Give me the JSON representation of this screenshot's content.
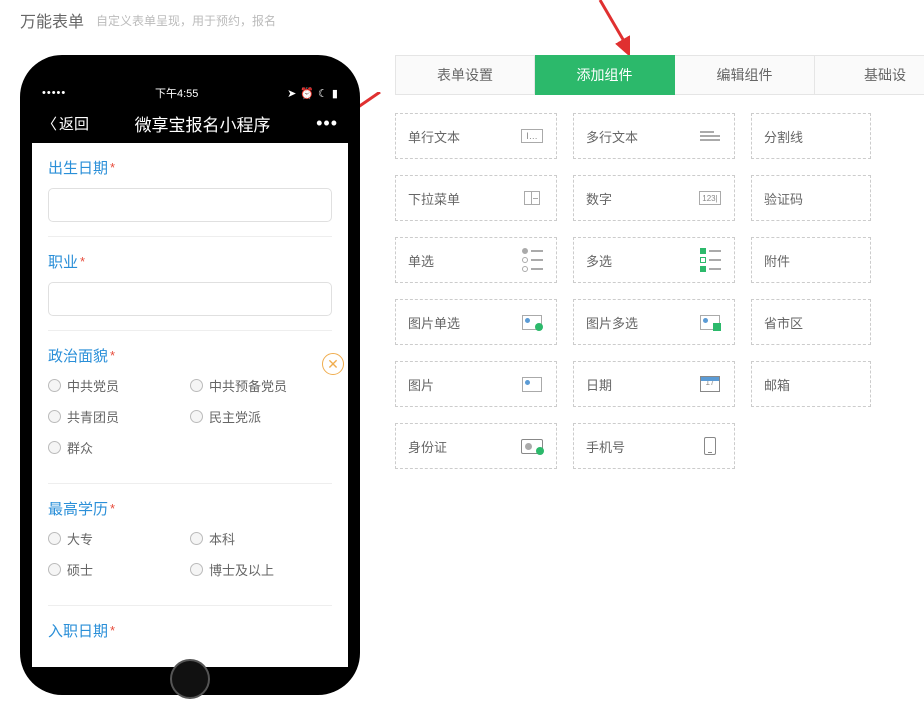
{
  "header": {
    "title": "万能表单",
    "subtitle": "自定义表单呈现，用于预约，报名"
  },
  "phone": {
    "status_dots": "•••••",
    "status_time": "下午4:55",
    "nav_back": "返回",
    "nav_title": "微享宝报名小程序",
    "nav_more": "•••"
  },
  "form": {
    "birth_label": "出生日期",
    "job_label": "职业",
    "political_label": "政治面貌",
    "political_options": [
      "中共党员",
      "中共预备党员",
      "共青团员",
      "民主党派",
      "群众"
    ],
    "edu_label": "最高学历",
    "edu_options": [
      "大专",
      "本科",
      "硕士",
      "博士及以上"
    ],
    "entry_label": "入职日期"
  },
  "tabs": {
    "settings": "表单设置",
    "add": "添加组件",
    "edit": "编辑组件",
    "basic": "基础设"
  },
  "components": {
    "col1": [
      {
        "label": "单行文本",
        "icon": "text"
      },
      {
        "label": "下拉菜单",
        "icon": "select"
      },
      {
        "label": "单选",
        "icon": "radio"
      },
      {
        "label": "图片单选",
        "icon": "pic-radio"
      },
      {
        "label": "图片",
        "icon": "pic"
      },
      {
        "label": "身份证",
        "icon": "id"
      }
    ],
    "col2": [
      {
        "label": "多行文本",
        "icon": "multiline"
      },
      {
        "label": "数字",
        "icon": "number"
      },
      {
        "label": "多选",
        "icon": "check"
      },
      {
        "label": "图片多选",
        "icon": "pic-check"
      },
      {
        "label": "日期",
        "icon": "date"
      },
      {
        "label": "手机号",
        "icon": "phone"
      }
    ],
    "col3": [
      {
        "label": "分割线"
      },
      {
        "label": "验证码"
      },
      {
        "label": "附件"
      },
      {
        "label": "省市区"
      },
      {
        "label": "邮箱"
      }
    ]
  }
}
